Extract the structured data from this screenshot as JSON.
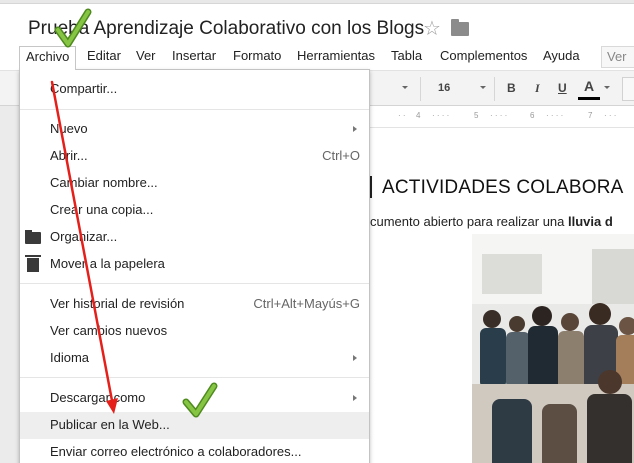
{
  "header": {
    "doc_title": "Prueba Aprendizaje Colaborativo con los Blogs",
    "star_icon": "star-outline-icon",
    "folder_icon": "folder-icon"
  },
  "menubar": {
    "items": [
      "Archivo",
      "Editar",
      "Ver",
      "Insertar",
      "Formato",
      "Herramientas",
      "Tabla",
      "Complementos",
      "Ayuda"
    ],
    "right_button": "Ver"
  },
  "toolbar": {
    "font_size": "16",
    "bold": "B",
    "italic": "I",
    "underline": "U",
    "text_color": "A"
  },
  "ruler": {
    "marks": [
      "4",
      "5",
      "6",
      "7"
    ]
  },
  "document": {
    "heading": "ACTIVIDADES COLABORA",
    "body_prefix": "cumento abierto para realizar una ",
    "body_bold": "lluvia d"
  },
  "file_menu": {
    "share": "Compartir...",
    "new": "Nuevo",
    "open": "Abrir...",
    "open_shortcut": "Ctrl+O",
    "rename": "Cambiar nombre...",
    "make_copy": "Crear una copia...",
    "organize": "Organizar...",
    "move_to_trash": "Mover a la papelera",
    "revision_history": "Ver historial de revisión",
    "revision_shortcut": "Ctrl+Alt+Mayús+G",
    "see_new_changes": "Ver cambios nuevos",
    "language": "Idioma",
    "download_as": "Descargar como",
    "publish_to_web": "Publicar en la Web...",
    "email_collaborators": "Enviar correo electrónico a colaboradores..."
  },
  "annotations": {
    "arrow_color": "#e5201b",
    "check_color": "#7ab536"
  }
}
